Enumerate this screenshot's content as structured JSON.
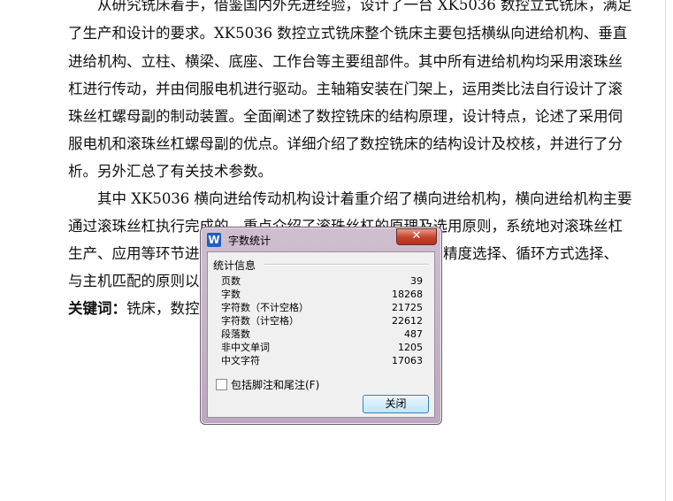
{
  "document": {
    "lines": [
      "从研究铣床着手，借鉴国内外先进经验，设计了一台 XK5036 数控立式铣床，满足",
      "了生产和设计的要求。XK5036 数控立式铣床整个铣床主要包括横纵向进给机构、垂直",
      "进给机构、立柱、横梁、底座、工作台等主要组部件。其中所有进给机构均采用滚珠丝",
      "杠进行传动，并由伺服电机进行驱动。主轴箱安装在门架上，运用类比法自行设计了滚",
      "珠丝杠螺母副的制动装置。全面阐述了数控铣床的结构原理，设计特点，论述了采用伺",
      "服电机和滚珠丝杠螺母副的优点。详细介绍了数控铣床的结构设计及校核，并进行了分",
      "析。另外汇总了有关技术参数。",
      "其中 XK5036 横向进给传动机构设计着重介绍了横向进给机构，横向进给机构主要",
      "通过滚珠丝杠执行完成的，重点介绍了滚珠丝杠的原理及选用原则，系统地对滚珠丝杠",
      "生产、应用等环节进",
      "与主机匹配的原则以",
      "铣床，数控"
    ],
    "line9_tail": "精度选择、循环方式选择、",
    "keywords_label": "关键词："
  },
  "dialog": {
    "title": "字数统计",
    "app_icon_letter": "W",
    "close_x": "✕",
    "group_label": "统计信息",
    "stats": [
      {
        "label": "页数",
        "value": "39"
      },
      {
        "label": "字数",
        "value": "18268"
      },
      {
        "label": "字符数（不计空格）",
        "value": "21725"
      },
      {
        "label": "字符数（计空格）",
        "value": "22612"
      },
      {
        "label": "段落数",
        "value": "487"
      },
      {
        "label": "非中文单词",
        "value": "1205"
      },
      {
        "label": "中文字符",
        "value": "17063"
      }
    ],
    "checkbox_label": "包括脚注和尾注(F)",
    "checkbox_checked": false,
    "close_button": "关闭"
  }
}
